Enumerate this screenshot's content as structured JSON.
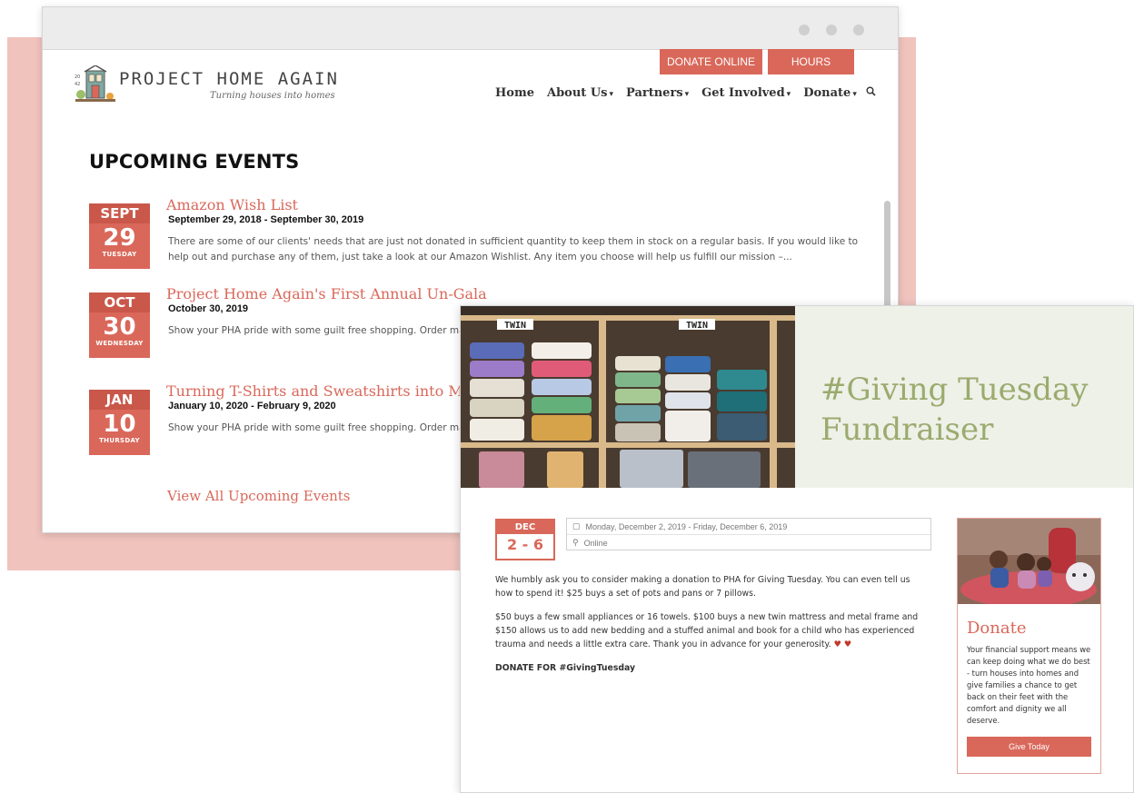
{
  "site": {
    "logo_name": "PROJECT HOME AGAIN",
    "logo_tagline": "Turning houses into homes",
    "top_buttons": {
      "donate_online": "DONATE ONLINE",
      "hours": "HOURS"
    },
    "nav": {
      "home": "Home",
      "about": "About Us",
      "partners": "Partners",
      "get_involved": "Get Involved",
      "donate": "Donate"
    },
    "accent_color": "#d9685a"
  },
  "events_page": {
    "title": "UPCOMING EVENTS",
    "events": [
      {
        "month": "SEPT",
        "day": "29",
        "weekday": "TUESDAY",
        "title": "Amazon Wish List",
        "range": "September 29, 2018 - September 30, 2019",
        "desc": "There are some of our clients' needs that are just not donated in sufficient quantity to keep them in stock on a regular basis. If you would like to help out and purchase any of them, just take a look at our Amazon Wishlist. Any item you choose will help us fulfill our mission –..."
      },
      {
        "month": "OCT",
        "day": "30",
        "weekday": "WEDNESDAY",
        "title": "Project Home Again's First Annual Un-Gala",
        "range": "October 30, 2019",
        "desc": "Show your PHA pride with some guilt free shopping. Order mattresses for children who do not have a clean, comfortable"
      },
      {
        "month": "JAN",
        "day": "10",
        "weekday": "THURSDAY",
        "title": "Turning T-Shirts and Sweatshirts into M",
        "range": "January 10, 2020 - February 9, 2020",
        "desc": "Show your PHA pride with some guilt free shopping. Order mattresses for children who do not have a clean, comfortable"
      }
    ],
    "view_all": "View All Upcoming Events"
  },
  "event_detail": {
    "photo_labels": [
      "TWIN",
      "TWIN"
    ],
    "title_line1": "#Giving Tuesday",
    "title_line2": "Fundraiser",
    "date_month": "DEC",
    "date_days": "2 - 6",
    "when": "Monday, December 2, 2019 - Friday, December 6, 2019",
    "where": "Online",
    "para1": "We humbly ask you to consider making a donation to PHA for Giving Tuesday. You can even tell us how to spend it! $25 buys a set of pots and pans or 7 pillows.",
    "para2": "$50 buys a few small appliances or 16 towels. $100 buys a new twin mattress and metal frame and $150 allows us to add new bedding and a stuffed animal and book for a child who has experienced trauma and needs a little extra care. Thank you in advance for your generosity.",
    "cta": "DONATE FOR #GivingTuesday",
    "donate_card": {
      "title": "Donate",
      "text": "Your financial support means we can keep doing what we do best - turn houses into homes and give families a chance to get back on their feet with the comfort and dignity we all deserve.",
      "button": "Give Today"
    }
  }
}
